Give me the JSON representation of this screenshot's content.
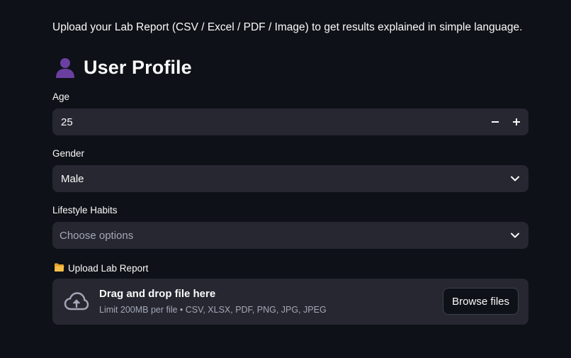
{
  "intro_text": "Upload your Lab Report (CSV / Excel / PDF / Image) to get results explained in simple language.",
  "profile": {
    "title": "User Profile",
    "icon": "person-silhouette-icon"
  },
  "age": {
    "label": "Age",
    "value": "25",
    "decrement": "−",
    "increment": "+"
  },
  "gender": {
    "label": "Gender",
    "selected": "Male"
  },
  "lifestyle": {
    "label": "Lifestyle Habits",
    "placeholder": "Choose options"
  },
  "upload": {
    "label": "Upload Lab Report",
    "icon": "folder-icon",
    "drop_text": "Drag and drop file here",
    "limit_text": "Limit 200MB per file • CSV, XLSX, PDF, PNG, JPG, JPEG",
    "browse_label": "Browse files"
  },
  "colors": {
    "background": "#0e1117",
    "field_bg": "#262730",
    "text": "#fafafa",
    "muted": "#a3a8b8",
    "avatar": "#6b3fa0",
    "folder": "#f2b632"
  }
}
